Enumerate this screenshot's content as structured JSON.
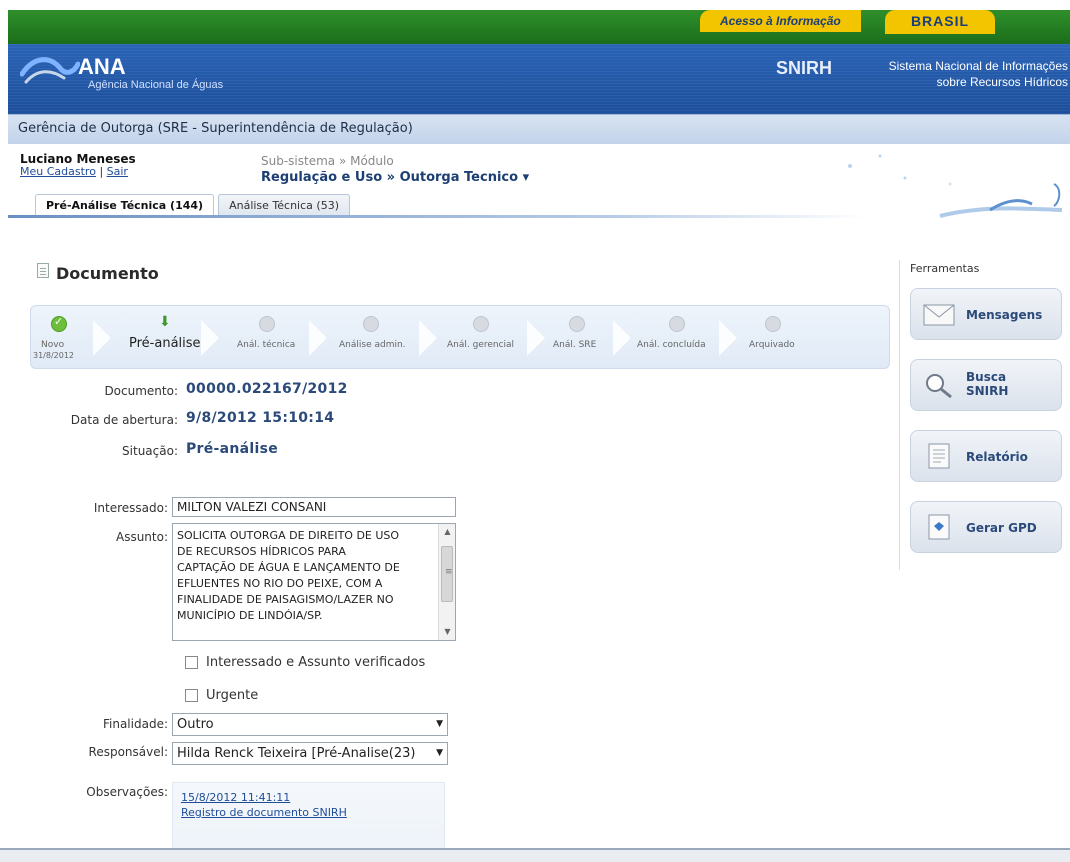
{
  "gov": {
    "access_label": "Acesso à Informação",
    "brasil_label": "BRASIL"
  },
  "header": {
    "brand": "ANA",
    "brand_sub": "Agência Nacional de Águas",
    "snirh_logo": "SNIRH",
    "snirh_line1": "Sistema Nacional de Informações",
    "snirh_line2": "sobre Recursos Hídricos"
  },
  "section": {
    "title": "Gerência de Outorga (SRE - Superintendência de Regulação)"
  },
  "user": {
    "name": "Luciano Meneses",
    "link_profile": "Meu Cadastro",
    "separator": "|",
    "link_logout": "Sair",
    "breadcrumb_label": "Sub-sistema » Módulo",
    "breadcrumb_value": "Regulação e Uso » Outorga Tecnico ▾"
  },
  "tabs": [
    {
      "label": "Pré-Análise Técnica (144)",
      "active": true
    },
    {
      "label": "Análise Técnica (53)",
      "active": false
    }
  ],
  "document": {
    "title": "Documento",
    "steps": [
      {
        "label": "Novo",
        "sub": "31/8/2012",
        "state": "done"
      },
      {
        "label": "Pré-análise",
        "sub": "",
        "state": "current"
      },
      {
        "label": "Anál. técnica",
        "sub": "",
        "state": "pending"
      },
      {
        "label": "Análise admin.",
        "sub": "",
        "state": "pending"
      },
      {
        "label": "Anál. gerencial",
        "sub": "",
        "state": "pending"
      },
      {
        "label": "Anál. SRE",
        "sub": "",
        "state": "pending"
      },
      {
        "label": "Anál. concluída",
        "sub": "",
        "state": "pending"
      },
      {
        "label": "Arquivado",
        "sub": "",
        "state": "pending"
      }
    ],
    "info": {
      "documento_label": "Documento:",
      "documento_value": "00000.022167/2012",
      "data_label": "Data de abertura:",
      "data_value": "9/8/2012 15:10:14",
      "situacao_label": "Situação:",
      "situacao_value": "Pré-análise"
    }
  },
  "form": {
    "interessado_label": "Interessado:",
    "interessado_value": "MILTON VALEZI CONSANI",
    "assunto_label": "Assunto:",
    "assunto_lines": [
      "SOLICITA OUTORGA DE DIREITO DE USO",
      "DE RECURSOS HÍDRICOS PARA",
      "CAPTAÇÃO DE ÁGUA E LANÇAMENTO DE",
      "EFLUENTES NO RIO DO PEIXE, COM A",
      "FINALIDADE DE PAISAGISMO/LAZER NO",
      "MUNICÍPIO DE LINDÓIA/SP."
    ],
    "check_verificados": "Interessado e Assunto verificados",
    "check_urgente": "Urgente",
    "finalidade_label": "Finalidade:",
    "finalidade_value": "Outro",
    "responsavel_label": "Responsável:",
    "responsavel_value": "Hilda Renck Teixeira [Pré-Analise(23)",
    "observacoes_label": "Observações:",
    "obs_date": "15/8/2012 11:41:11",
    "obs_text": "Registro de documento SNIRH"
  },
  "tools": {
    "title": "Ferramentas",
    "items": [
      {
        "label": "Mensagens",
        "icon": "envelope-icon"
      },
      {
        "label_line1": "Busca",
        "label_line2": "SNIRH",
        "icon": "search-icon"
      },
      {
        "label": "Relatório",
        "icon": "report-icon"
      },
      {
        "label": "Gerar GPD",
        "icon": "gpd-icon"
      }
    ]
  }
}
